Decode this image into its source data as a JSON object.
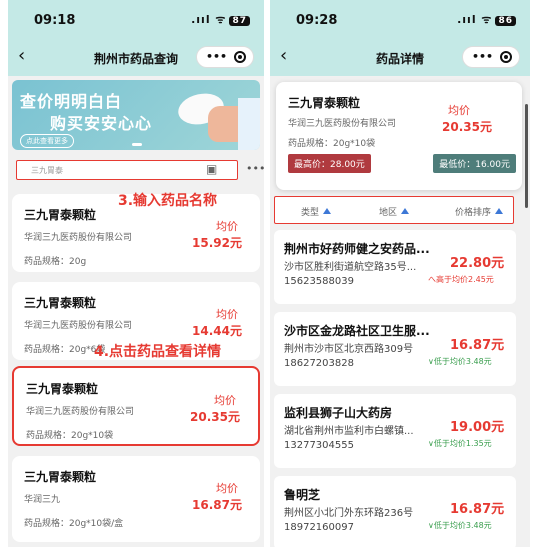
{
  "left": {
    "status": {
      "time": "09:18",
      "battery": "87"
    },
    "nav": {
      "title": "荆州市药品查询",
      "back": "‹",
      "more": "•••"
    },
    "banner": {
      "line1": "查价明明白白",
      "line2": "购买安安心心",
      "button": "点此查看更多"
    },
    "search": {
      "placeholder": "三九胃泰",
      "more": "•••"
    },
    "annotation3": "3.输入药品名称",
    "annotation4": "4.点击药品查看详情",
    "cards": [
      {
        "name": "三九胃泰颗粒",
        "maker": "华润三九医药股份有限公司",
        "spec": "药品规格：20g",
        "avg_label": "均价",
        "avg": "15.92元"
      },
      {
        "name": "三九胃泰颗粒",
        "maker": "华润三九医药股份有限公司",
        "spec": "药品规格：20g*6袋",
        "avg_label": "均价",
        "avg": "14.44元"
      },
      {
        "name": "三九胃泰颗粒",
        "maker": "华润三九医药股份有限公司",
        "spec": "药品规格：20g*10袋",
        "avg_label": "均价",
        "avg": "20.35元"
      },
      {
        "name": "三九胃泰颗粒",
        "maker": "华润三九",
        "spec": "药品规格：20g*10袋/盒",
        "avg_label": "均价",
        "avg": "16.87元"
      }
    ]
  },
  "right": {
    "status": {
      "time": "09:28",
      "battery": "86"
    },
    "nav": {
      "title": "药品详情",
      "back": "‹",
      "more": "•••"
    },
    "detail": {
      "name": "三九胃泰颗粒",
      "maker": "华润三九医药股份有限公司",
      "spec": "药品规格：20g*10袋",
      "avg_label": "均价",
      "avg": "20.35元",
      "max": "最高价：28.00元",
      "min": "最低价：16.00元"
    },
    "filters": [
      "类型",
      "地区",
      "价格排序"
    ],
    "stores": [
      {
        "name": "荆州市好药师健之安药品...",
        "addr": "沙市区胜利街道航空路35号...",
        "phone": "15623588039",
        "price": "22.80元",
        "diff": "へ高于均价2.45元",
        "dir": "up"
      },
      {
        "name": "沙市区金龙路社区卫生服...",
        "addr": "荆州市沙市区北京西路309号",
        "phone": "18627203828",
        "price": "16.87元",
        "diff": "∨低于均价3.48元",
        "dir": "dn"
      },
      {
        "name": "监利县狮子山大药房",
        "addr": "湖北省荆州市监利市白螺镇...",
        "phone": "13277304555",
        "price": "19.00元",
        "diff": "∨低于均价1.35元",
        "dir": "dn"
      },
      {
        "name": "鲁明芝",
        "addr": "荆州区小北门外东环路236号",
        "phone": "18972160097",
        "price": "16.87元",
        "diff": "∨低于均价3.48元",
        "dir": "dn"
      }
    ]
  },
  "colors": {
    "header": "#c4e9e6",
    "accent": "#e63a32",
    "max_badge": "#b03a3f",
    "min_badge": "#4e7d7a",
    "lower": "#3a9e4e"
  }
}
